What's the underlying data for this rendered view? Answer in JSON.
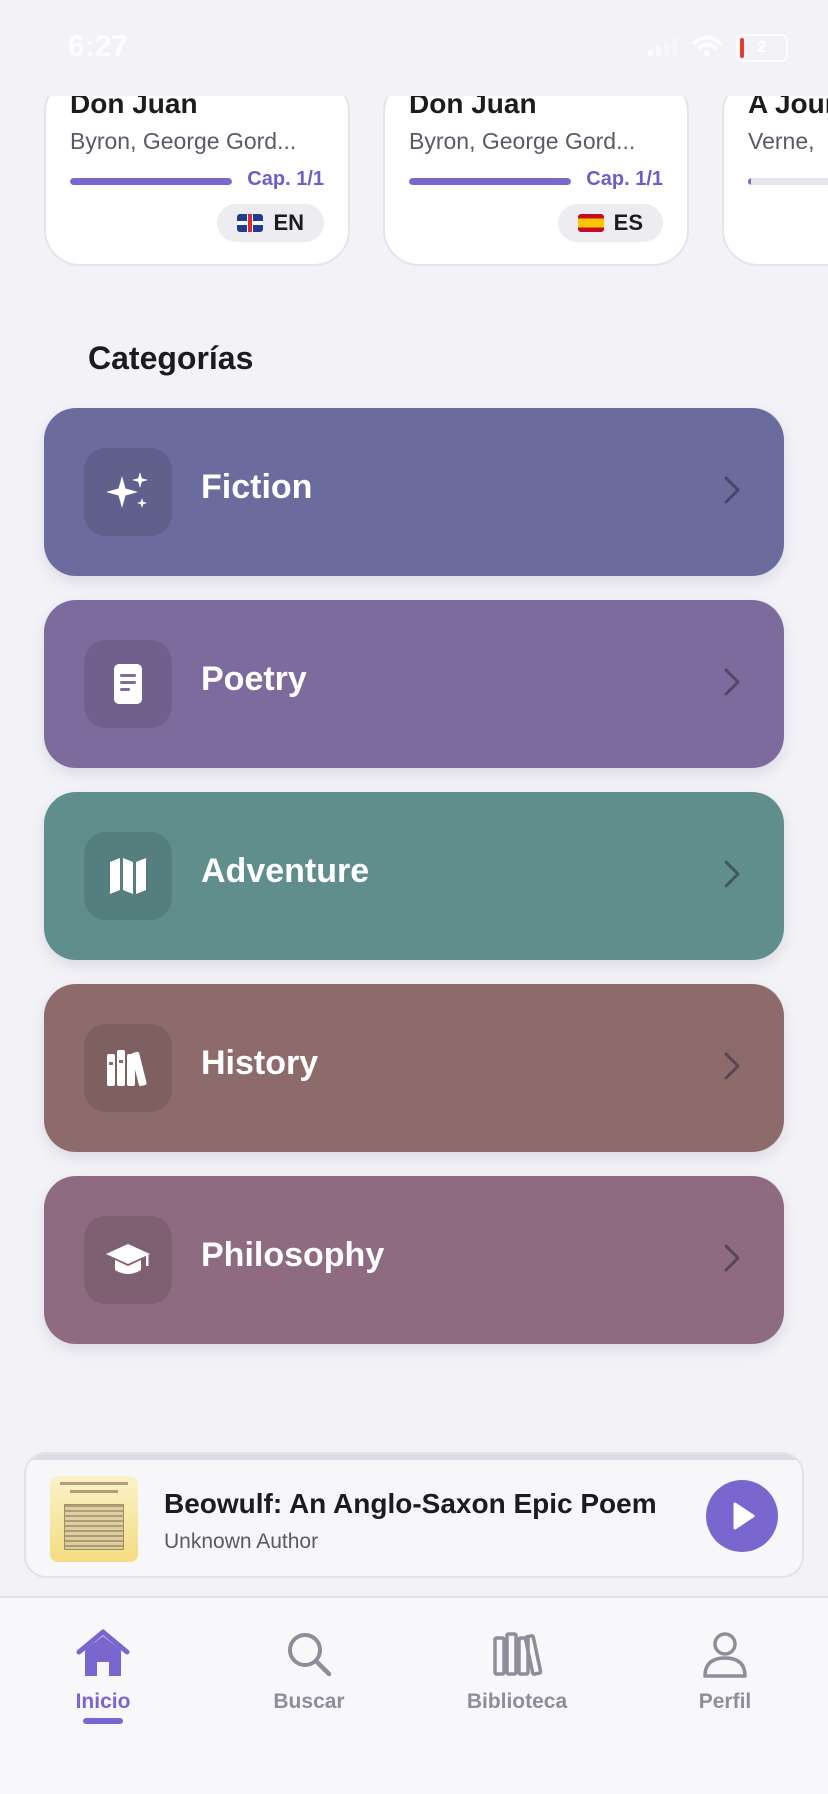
{
  "status_bar": {
    "time": "6:27",
    "battery": "2"
  },
  "continue_reading": [
    {
      "title": "Don Juan",
      "author": "Byron, George Gord...",
      "progress": 1.0,
      "chapter": "Cap. 1/1",
      "lang": "EN"
    },
    {
      "title": "Don Juan",
      "author": "Byron, George Gord...",
      "progress": 1.0,
      "chapter": "Cap. 1/1",
      "lang": "ES"
    },
    {
      "title": "A Jour",
      "author": "Verne,",
      "progress": 0.02,
      "chapter": "",
      "lang": ""
    }
  ],
  "categories_title": "Categorías",
  "categories": [
    {
      "label": "Fiction",
      "color": "#6b6b9e",
      "icon": "sparkles-icon"
    },
    {
      "label": "Poetry",
      "color": "#7e6b9e",
      "icon": "document-icon"
    },
    {
      "label": "Adventure",
      "color": "#5f8e8d",
      "icon": "map-icon"
    },
    {
      "label": "History",
      "color": "#8d6b6b",
      "icon": "library-icon"
    },
    {
      "label": "Philosophy",
      "color": "#8e6b80",
      "icon": "graduation-cap-icon"
    }
  ],
  "mini_player": {
    "title": "Beowulf: An Anglo-Saxon Epic Poem",
    "author": "Unknown Author"
  },
  "tabs": [
    {
      "label": "Inicio",
      "icon": "home-icon",
      "active": true
    },
    {
      "label": "Buscar",
      "icon": "search-icon",
      "active": false
    },
    {
      "label": "Biblioteca",
      "icon": "books-icon",
      "active": false
    },
    {
      "label": "Perfil",
      "icon": "person-icon",
      "active": false
    }
  ],
  "colors": {
    "accent": "#7a66cf"
  }
}
